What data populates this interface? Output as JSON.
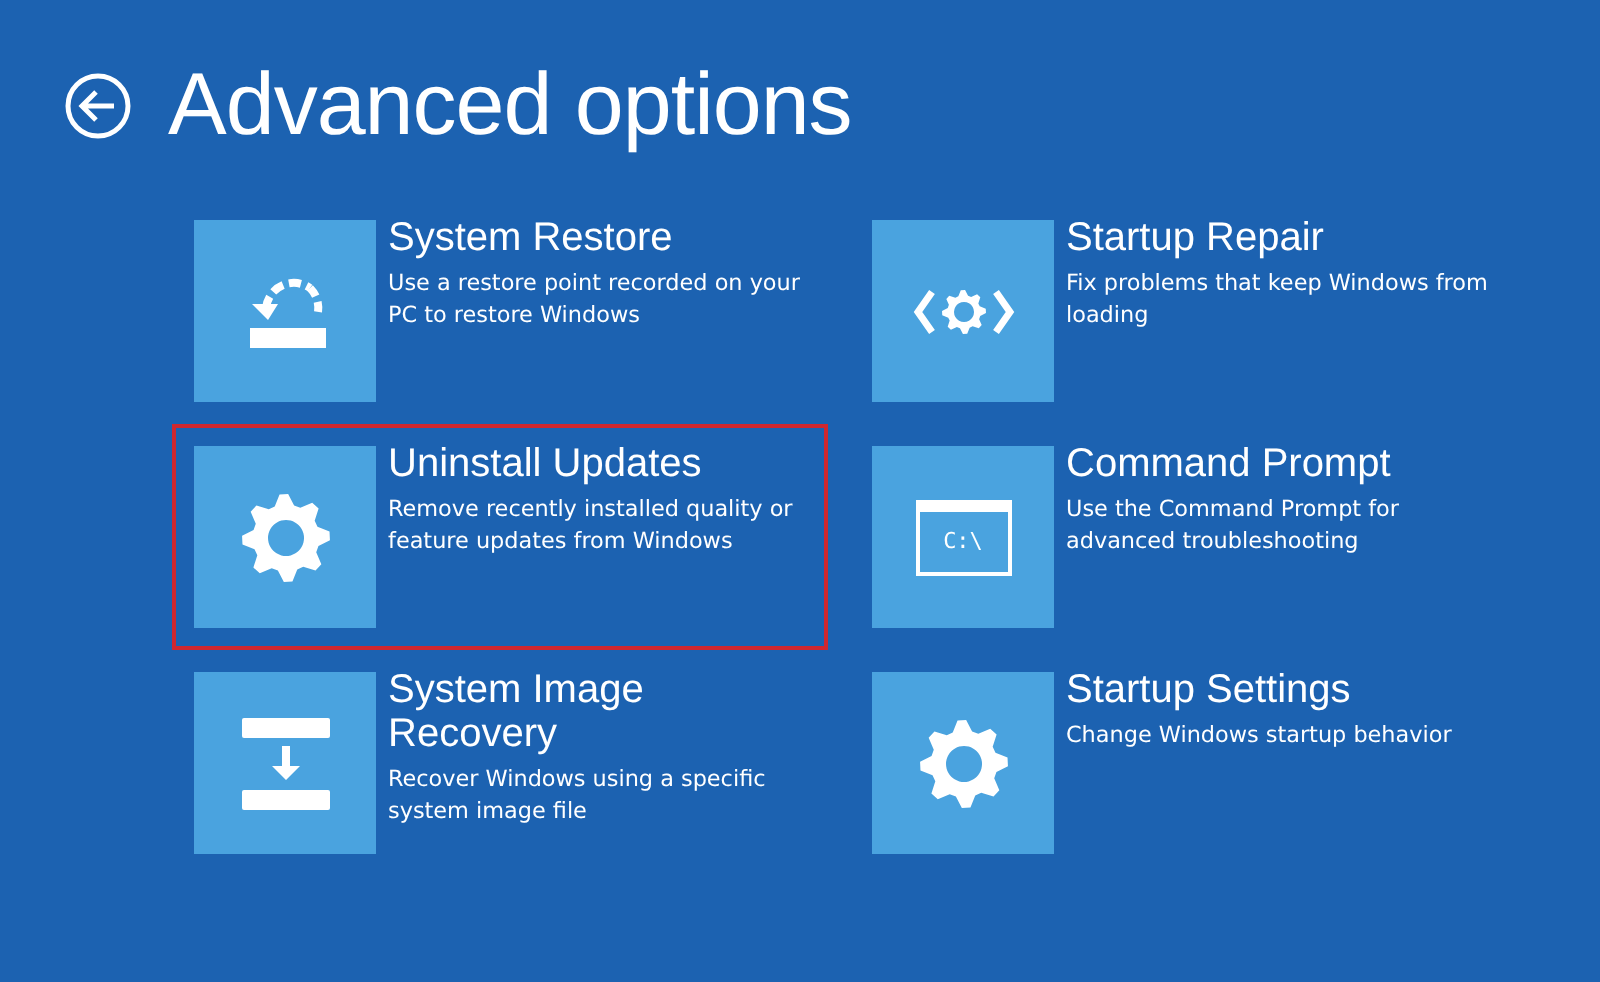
{
  "header": {
    "title": "Advanced options"
  },
  "options": [
    {
      "kind": "restore",
      "title": "System Restore",
      "description": "Use a restore point recorded on your PC to restore Windows",
      "highlighted": false
    },
    {
      "kind": "repair",
      "title": "Startup Repair",
      "description": "Fix problems that keep Windows from loading",
      "highlighted": false
    },
    {
      "kind": "gear",
      "title": "Uninstall Updates",
      "description": "Remove recently installed quality or feature updates from Windows",
      "highlighted": true
    },
    {
      "kind": "prompt",
      "title": "Command Prompt",
      "description": "Use the Command Prompt for advanced troubleshooting",
      "highlighted": false,
      "icon_text": "C:\\"
    },
    {
      "kind": "image",
      "title": "System Image Recovery",
      "description": "Recover Windows using a specific system image file",
      "highlighted": false
    },
    {
      "kind": "gear",
      "title": "Startup Settings",
      "description": "Change Windows startup behavior",
      "highlighted": false
    }
  ]
}
